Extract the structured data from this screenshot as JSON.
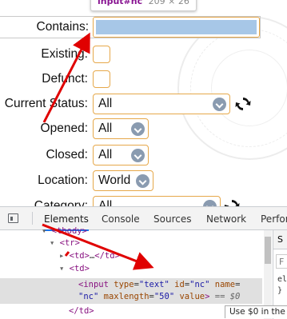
{
  "tooltip": {
    "selector": "input#nc",
    "dims": "209 × 26"
  },
  "form": {
    "contains_label": "Contains:",
    "existing_label": "Existing:",
    "defunct_label": "Defunct:",
    "current_status_label": "Current Status:",
    "current_status_value": "All",
    "opened_label": "Opened:",
    "opened_value": "All",
    "closed_label": "Closed:",
    "closed_value": "All",
    "location_label": "Location:",
    "location_value": "World",
    "category_label": "Category:",
    "category_value": "All"
  },
  "devtools": {
    "tabs": [
      "Elements",
      "Console",
      "Sources",
      "Network",
      "Perfor"
    ],
    "active_tab": "Elements",
    "lines": {
      "l0": "<tbody>",
      "l1": "<tr>",
      "l2_open": "<td>",
      "l2_mid": "…",
      "l2_close": "</td>",
      "l3": "<td>",
      "l4_tag": "<input",
      "l4_a1": "type",
      "l4_v1": "\"text\"",
      "l4_a2": "id",
      "l4_v2": "\"nc\"",
      "l4_a3": "name",
      "l5_v3": "\"nc\"",
      "l5_a4": "maxlength",
      "l5_v4": "\"50\"",
      "l5_a5": "value",
      "l5_close": ">",
      "l5_eq": "== $0",
      "l6": "</td>"
    },
    "styles_tab": "S",
    "filter_placeholder": "F",
    "styles_line1": "el",
    "styles_line2": "}",
    "console_hint": "Use $0 in the"
  },
  "colors": {
    "accent_border": "#e6a84a",
    "selection_fill": "#a7c7e7",
    "annotation_arrow": "#e00000",
    "tab_underline": "#1a73e8"
  }
}
